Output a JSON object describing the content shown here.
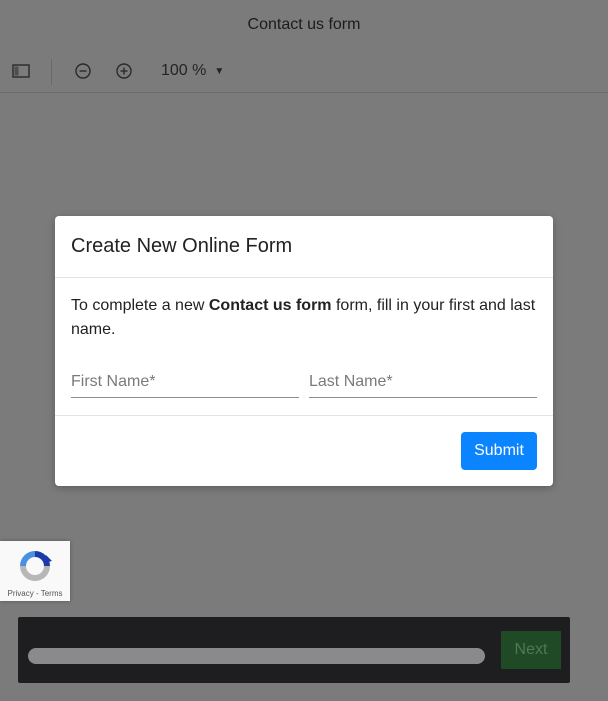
{
  "viewer": {
    "title": "Contact us form",
    "zoom_label": "100 %",
    "icons": {
      "sidebar": "sidebar-toggle-icon",
      "zoom_out": "zoom-out-icon",
      "zoom_in": "zoom-in-icon",
      "zoom_caret": "caret-down-icon"
    }
  },
  "modal": {
    "title": "Create New Online Form",
    "text_before": "To complete a new ",
    "text_bold": "Contact us form",
    "text_after": " form, fill in your first and last name.",
    "first_name_placeholder": "First Name*",
    "last_name_placeholder": "Last Name*",
    "submit_label": "Submit"
  },
  "recaptcha": {
    "privacy": "Privacy",
    "separator": " - ",
    "terms": "Terms"
  },
  "bottom_bar": {
    "progress": 1.0,
    "next_label": "Next"
  },
  "colors": {
    "overlay": "#7b7b7b",
    "accent": "#0a84ff",
    "next_bg": "#204a26"
  }
}
